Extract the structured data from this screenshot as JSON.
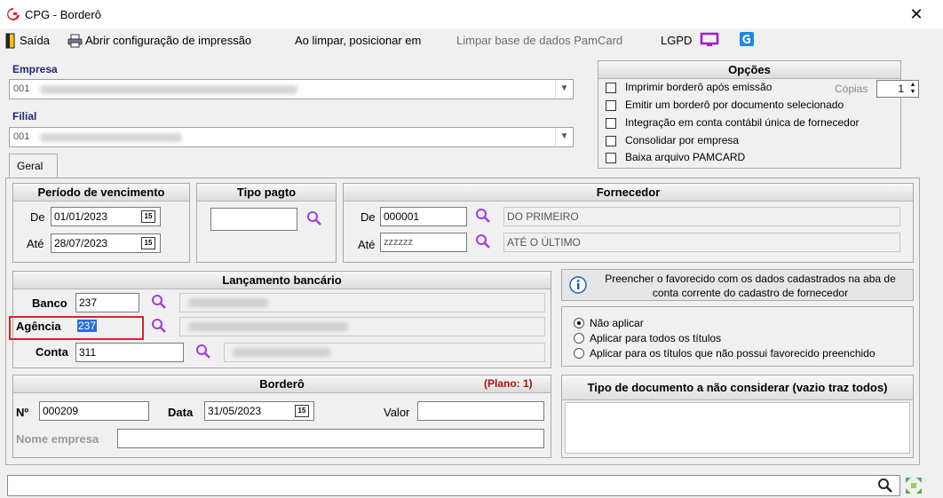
{
  "window": {
    "title": "CPG - Borderô",
    "close": "✕"
  },
  "toolbar": {
    "exit": "Saída",
    "print_config": "Abrir configuração de impressão",
    "on_clear": "Ao limpar, posicionar em",
    "clear_pamcard": "Limpar base de dados PamCard",
    "lgpd": "LGPD"
  },
  "empresa": {
    "label": "Empresa",
    "value": "001"
  },
  "filial": {
    "label": "Filial",
    "value": "001"
  },
  "opcoes": {
    "title": "Opções",
    "items": [
      "Imprimir borderô após emissão",
      "Emitir um borderô por documento selecionado",
      "Integração em conta contábil única de fornecedor",
      "Consolidar por empresa",
      "Baixa arquivo PAMCARD"
    ],
    "copias_label": "Cópias",
    "copias_value": "1"
  },
  "tabs": {
    "geral": "Geral"
  },
  "periodo": {
    "title": "Período de vencimento",
    "de_label": "De",
    "de_value": "01/01/2023",
    "ate_label": "Até",
    "ate_value": "28/07/2023"
  },
  "tipo_pagto": {
    "title": "Tipo pagto",
    "value": ""
  },
  "fornecedor": {
    "title": "Fornecedor",
    "de_label": "De",
    "de_code": "000001",
    "de_name": "DO PRIMEIRO",
    "ate_label": "Até",
    "ate_code": "zzzzzz",
    "ate_name": "ATÉ O ÚLTIMO"
  },
  "lancamento": {
    "title": "Lançamento bancário",
    "banco_label": "Banco",
    "banco_value": "237",
    "agencia_label": "Agência",
    "agencia_value": "237",
    "conta_label": "Conta",
    "conta_value": "311"
  },
  "favorecido": {
    "info": "Preencher o favorecido com os dados cadastrados na aba de conta corrente do cadastro de fornecedor",
    "options": [
      "Não aplicar",
      "Aplicar para todos os títulos",
      "Aplicar para os títulos que não possui favorecido preenchido"
    ],
    "selected": 0
  },
  "bordero": {
    "title": "Borderô",
    "plano": "(Plano: 1)",
    "num_label": "Nº",
    "num_value": "000209",
    "data_label": "Data",
    "data_value": "31/05/2023",
    "valor_label": "Valor",
    "valor_value": "",
    "nome_label": "Nome empresa",
    "nome_value": ""
  },
  "tipo_doc": {
    "title": "Tipo de documento a não considerar (vazio traz todos)"
  },
  "footer": {
    "search_value": ""
  },
  "colors": {
    "accent": "#1b2a78",
    "highlight_box": "#d9232d",
    "plano": "#b01010",
    "icon_purple": "#8a2be2"
  }
}
